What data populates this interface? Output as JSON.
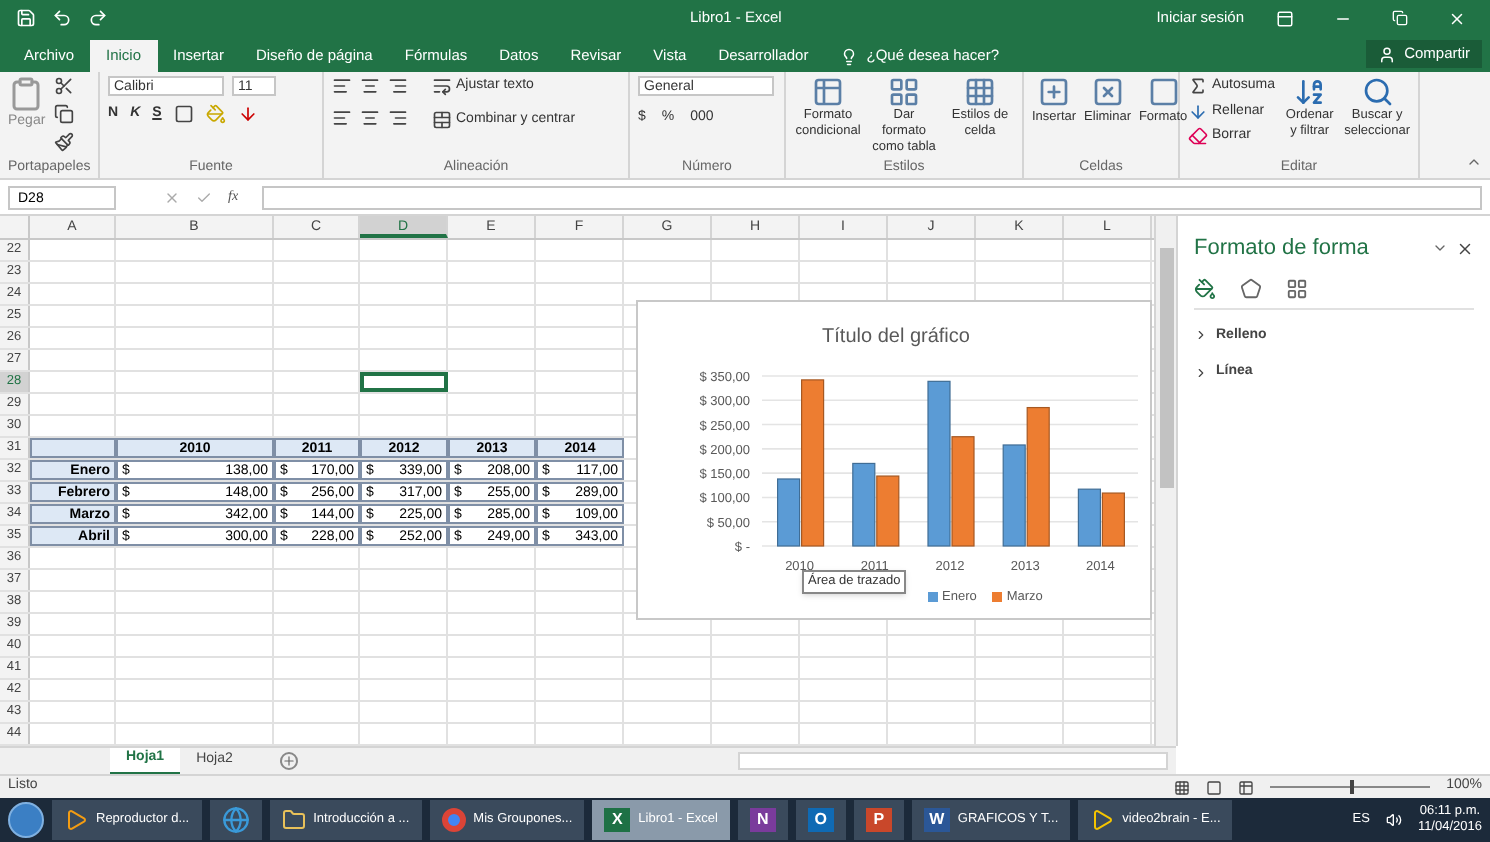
{
  "window": {
    "title": "Libro1 - Excel",
    "account": "Iniciar sesión"
  },
  "ribbon_tabs": [
    {
      "label": "Archivo",
      "selected": false
    },
    {
      "label": "Inicio",
      "selected": true
    },
    {
      "label": "Insertar",
      "selected": false
    },
    {
      "label": "Diseño de página",
      "selected": false
    },
    {
      "label": "Fórmulas",
      "selected": false
    },
    {
      "label": "Datos",
      "selected": false
    },
    {
      "label": "Revisar",
      "selected": false
    },
    {
      "label": "Vista",
      "selected": false
    },
    {
      "label": "Desarrollador",
      "selected": false
    }
  ],
  "tell_me": "¿Qué desea hacer?",
  "share": "Compartir",
  "ribbon": {
    "clipboard": {
      "paste": "Pegar",
      "label": "Portapapeles"
    },
    "font": {
      "family": "Calibri",
      "size": "11",
      "bold": "N",
      "italic": "K",
      "underline": "S",
      "label": "Fuente"
    },
    "alignment": {
      "wrap": "Ajustar texto",
      "merge": "Combinar y centrar",
      "label": "Alineación"
    },
    "number": {
      "format": "General",
      "currency": "$",
      "percent": "%",
      "thousands": "000",
      "label": "Número"
    },
    "styles": {
      "buttons": [
        "Formato condicional",
        "Dar formato como tabla",
        "Estilos de celda"
      ],
      "label": "Estilos"
    },
    "cells": {
      "buttons": [
        "Insertar",
        "Eliminar",
        "Formato"
      ],
      "label": "Celdas"
    },
    "editing": {
      "autosum": "Autosuma",
      "fill": "Rellenar",
      "clear": "Borrar",
      "sort": "Ordenar y filtrar",
      "find": "Buscar y seleccionar",
      "label": "Editar"
    }
  },
  "formula_bar": {
    "name_box": "D28",
    "function_symbol": "fx"
  },
  "sheet": {
    "columns": [
      {
        "label": "A",
        "selected": false
      },
      {
        "label": "B",
        "selected": false
      },
      {
        "label": "C",
        "selected": false
      },
      {
        "label": "D",
        "selected": true
      },
      {
        "label": "E",
        "selected": false
      },
      {
        "label": "F",
        "selected": false
      },
      {
        "label": "G",
        "selected": false
      },
      {
        "label": "H",
        "selected": false
      },
      {
        "label": "I",
        "selected": false
      },
      {
        "label": "J",
        "selected": false
      },
      {
        "label": "K",
        "selected": false
      },
      {
        "label": "L",
        "selected": false
      }
    ],
    "rows": [
      {
        "number": "22",
        "selected": false
      },
      {
        "number": "23",
        "selected": false
      },
      {
        "number": "24",
        "selected": false
      },
      {
        "number": "25",
        "selected": false
      },
      {
        "number": "26",
        "selected": false
      },
      {
        "number": "27",
        "selected": false
      },
      {
        "number": "28",
        "selected": true
      },
      {
        "number": "29",
        "selected": false
      },
      {
        "number": "30",
        "selected": false
      },
      {
        "number": "31",
        "selected": false
      },
      {
        "number": "32",
        "selected": false
      },
      {
        "number": "33",
        "selected": false
      },
      {
        "number": "34",
        "selected": false
      },
      {
        "number": "35",
        "selected": false
      },
      {
        "number": "36",
        "selected": false
      },
      {
        "number": "37",
        "selected": false
      },
      {
        "number": "38",
        "selected": false
      },
      {
        "number": "39",
        "selected": false
      },
      {
        "number": "40",
        "selected": false
      },
      {
        "number": "41",
        "selected": false
      },
      {
        "number": "42",
        "selected": false
      },
      {
        "number": "43",
        "selected": false
      },
      {
        "number": "44",
        "selected": false
      }
    ],
    "table": {
      "header": [
        "2010",
        "2011",
        "2012",
        "2013",
        "2014"
      ],
      "rows": [
        {
          "label": "Enero",
          "values": [
            {
              "currency": "$",
              "amount": "138,00"
            },
            {
              "currency": "$",
              "amount": "170,00"
            },
            {
              "currency": "$",
              "amount": "339,00"
            },
            {
              "currency": "$",
              "amount": "208,00"
            },
            {
              "currency": "$",
              "amount": "117,00"
            }
          ]
        },
        {
          "label": "Febrero",
          "values": [
            {
              "currency": "$",
              "amount": "148,00"
            },
            {
              "currency": "$",
              "amount": "256,00"
            },
            {
              "currency": "$",
              "amount": "317,00"
            },
            {
              "currency": "$",
              "amount": "255,00"
            },
            {
              "currency": "$",
              "amount": "289,00"
            }
          ]
        },
        {
          "label": "Marzo",
          "values": [
            {
              "currency": "$",
              "amount": "342,00"
            },
            {
              "currency": "$",
              "amount": "144,00"
            },
            {
              "currency": "$",
              "amount": "225,00"
            },
            {
              "currency": "$",
              "amount": "285,00"
            },
            {
              "currency": "$",
              "amount": "109,00"
            }
          ]
        },
        {
          "label": "Abril",
          "values": [
            {
              "currency": "$",
              "amount": "300,00"
            },
            {
              "currency": "$",
              "amount": "228,00"
            },
            {
              "currency": "$",
              "amount": "252,00"
            },
            {
              "currency": "$",
              "amount": "249,00"
            },
            {
              "currency": "$",
              "amount": "343,00"
            }
          ]
        }
      ]
    },
    "chart": {
      "tooltip": "Área de trazado",
      "chart_data": {
        "type": "bar",
        "title": "Título del gráfico",
        "categories": [
          "2010",
          "2011",
          "2012",
          "2013",
          "2014"
        ],
        "series": [
          {
            "name": "Enero",
            "color": "#5b9bd5",
            "values": [
              138,
              170,
              339,
              208,
              117
            ]
          },
          {
            "name": "Marzo",
            "color": "#ed7d31",
            "values": [
              342,
              144,
              225,
              285,
              109
            ]
          }
        ],
        "ylim": [
          0,
          350
        ],
        "grid": true,
        "yticks": [
          {
            "value": 0,
            "label": "$ -"
          },
          {
            "value": 50,
            "label": "$ 50,00"
          },
          {
            "value": 100,
            "label": "$ 100,00"
          },
          {
            "value": 150,
            "label": "$ 150,00"
          },
          {
            "value": 200,
            "label": "$ 200,00"
          },
          {
            "value": 250,
            "label": "$ 250,00"
          },
          {
            "value": 300,
            "label": "$ 300,00"
          },
          {
            "value": 350,
            "label": "$ 350,00"
          }
        ]
      }
    }
  },
  "format_pane": {
    "title": "Formato de forma",
    "sections": [
      {
        "label": "Relleno",
        "expanded": false
      },
      {
        "label": "Línea",
        "expanded": false
      }
    ]
  },
  "sheet_tabs": [
    {
      "label": "Hoja1",
      "selected": true
    },
    {
      "label": "Hoja2",
      "selected": false
    }
  ],
  "status_bar": {
    "status": "Listo",
    "zoom": "100%",
    "zoom_slider": {
      "level": 0.5
    }
  },
  "taskbar": {
    "items": [
      {
        "kind": "player",
        "label": "Reproductor d...",
        "active": false
      },
      {
        "kind": "browser",
        "active": false
      },
      {
        "kind": "folder",
        "label": "Introducción a ...",
        "active": false
      },
      {
        "kind": "chrome",
        "label": "Mis Groupones...",
        "active": false
      },
      {
        "kind": "app",
        "glyph": "X",
        "color": "#1e7145",
        "label": "Libro1 - Excel",
        "active": true
      },
      {
        "kind": "app",
        "glyph": "N",
        "color": "#7a3b9c",
        "active": false
      },
      {
        "kind": "app",
        "glyph": "O",
        "color": "#0f6ab4",
        "active": false
      },
      {
        "kind": "app",
        "glyph": "P",
        "color": "#c9472a",
        "active": false
      },
      {
        "kind": "app",
        "glyph": "W",
        "color": "#2b5797",
        "label": "GRAFICOS Y T...",
        "active": false
      },
      {
        "kind": "video",
        "label": "video2brain - E...",
        "active": false
      }
    ],
    "language": "ES",
    "time": "06:11 p.m.",
    "date": "11/04/2016"
  }
}
